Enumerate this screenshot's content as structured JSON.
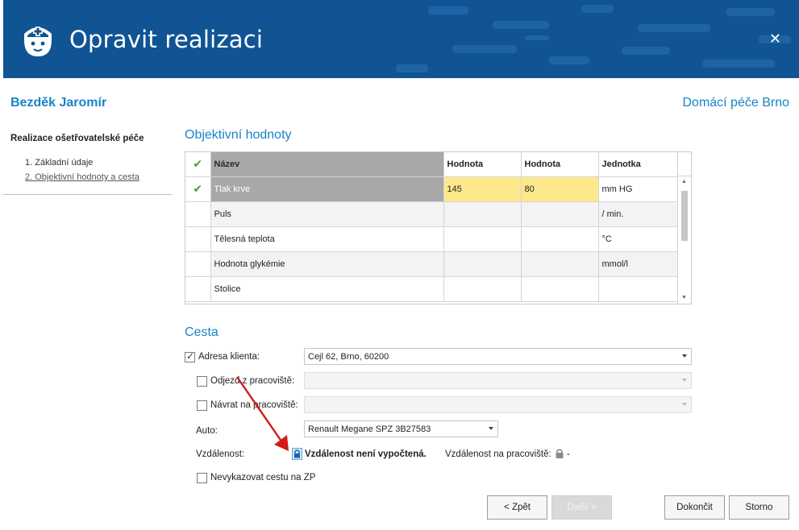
{
  "window": {
    "title": "Opravit realizaci",
    "close_label": "✕",
    "icon": "nurse-icon",
    "brand_color": "#105494"
  },
  "client": {
    "name": "Bezděk Jaromír",
    "organization": "Domácí péče Brno"
  },
  "sidebar": {
    "title": "Realizace ošetřovatelské péče",
    "steps": [
      {
        "label": "1. Základní údaje",
        "active": false
      },
      {
        "label": "2. Objektivní hodnoty a cesta",
        "active": true
      }
    ]
  },
  "objective": {
    "title": "Objektivní hodnoty",
    "columns": [
      "Název",
      "Hodnota",
      "Hodnota",
      "Jednotka"
    ],
    "rows": [
      {
        "checked": true,
        "name": "Tlak krve",
        "value1": "145",
        "value2": "80",
        "unit": "mm HG",
        "selected": true
      },
      {
        "checked": false,
        "name": "Puls",
        "value1": "",
        "value2": "",
        "unit": "/ min.",
        "selected": false
      },
      {
        "checked": false,
        "name": "Tělesná teplota",
        "value1": "",
        "value2": "",
        "unit": "°C",
        "selected": false
      },
      {
        "checked": false,
        "name": "Hodnota glykémie",
        "value1": "",
        "value2": "",
        "unit": "mmol/l",
        "selected": false
      },
      {
        "checked": false,
        "name": "Stolice",
        "value1": "",
        "value2": "",
        "unit": "",
        "selected": false
      }
    ],
    "check_glyph": "✔",
    "highlight_color": "#fde98c",
    "check_color": "#49a22c"
  },
  "route": {
    "title": "Cesta",
    "client_address": {
      "label": "Adresa klienta:",
      "checked": true,
      "value": "Cejl 62, Brno, 60200"
    },
    "departure": {
      "label": "Odjezd z pracoviště:",
      "checked": false,
      "value": ""
    },
    "return": {
      "label": "Návrat na pracoviště:",
      "checked": false,
      "value": ""
    },
    "car": {
      "label": "Auto:",
      "value": "Renault Megane SPZ 3B27583"
    },
    "distance": {
      "label": "Vzdálenost:",
      "status": "Vzdálenost není vypočtená.",
      "workplace_label": "Vzdálenost na pracoviště:",
      "workplace_value": "-"
    },
    "no_report": {
      "label": "Nevykazovat cestu na ZP",
      "checked": false
    },
    "check_glyph": "✓"
  },
  "buttons": {
    "back": "< Zpět",
    "next": "Další >",
    "finish": "Dokončit",
    "cancel": "Storno"
  }
}
